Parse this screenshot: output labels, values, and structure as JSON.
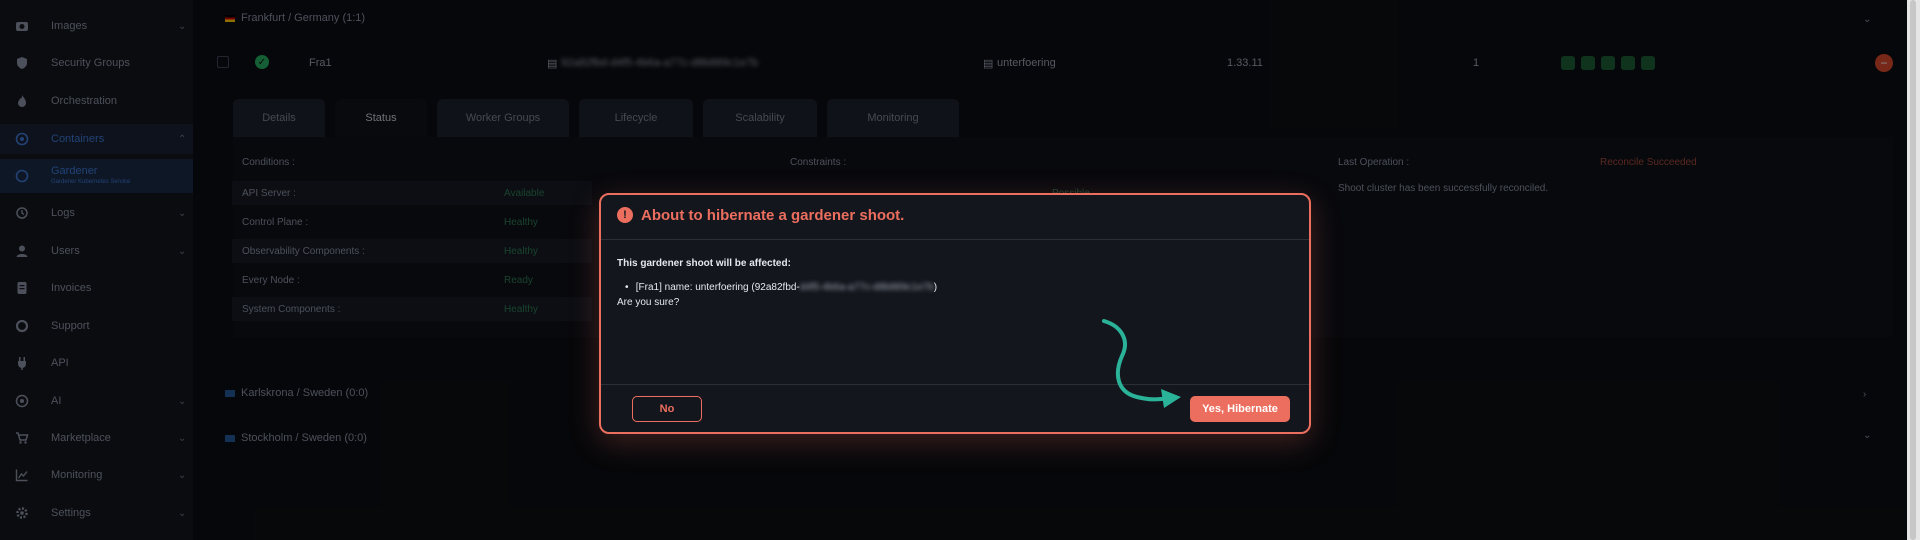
{
  "sidebar": {
    "items": [
      {
        "label": "Images",
        "icon": "camera-icon",
        "chevron": true
      },
      {
        "label": "Security Groups",
        "icon": "shield-icon",
        "chevron": false
      },
      {
        "label": "Orchestration",
        "icon": "flame-icon",
        "chevron": false
      },
      {
        "label": "Containers",
        "icon": "container-icon",
        "chevron": true
      },
      {
        "label": "Gardener",
        "sublabel": "Gardener Kubernetes Service",
        "icon": "gardener-icon"
      },
      {
        "label": "Logs",
        "icon": "history-icon",
        "chevron": true
      },
      {
        "label": "Users",
        "icon": "user-icon",
        "chevron": true
      },
      {
        "label": "Invoices",
        "icon": "invoice-icon",
        "chevron": false
      },
      {
        "label": "Support",
        "icon": "lifebuoy-icon",
        "chevron": false
      },
      {
        "label": "API",
        "icon": "plug-icon",
        "chevron": false
      },
      {
        "label": "AI",
        "icon": "ai-icon",
        "chevron": true
      },
      {
        "label": "Marketplace",
        "icon": "cart-icon",
        "chevron": true
      },
      {
        "label": "Monitoring",
        "icon": "chart-icon",
        "chevron": true
      },
      {
        "label": "Settings",
        "icon": "gear-icon",
        "chevron": true
      }
    ]
  },
  "regions": {
    "frankfurt": "Frankfurt / Germany (1:1)",
    "karlskrona": "Karlskrona / Sweden (0:0)",
    "stockholm": "Stockholm / Sweden (0:0)"
  },
  "shoot": {
    "name": "Fra1",
    "id": "92a82fbd-d4f5-4b6a-a77c-d8b889c1e7b",
    "project": "unterfoering",
    "version": "1.33.11",
    "count": "1"
  },
  "tabs": [
    "Details",
    "Status",
    "Worker Groups",
    "Lifecycle",
    "Scalability",
    "Monitoring"
  ],
  "status": {
    "conditions_title": "Conditions :",
    "constraints_title": "Constraints :",
    "last_operation_title": "Last Operation :",
    "last_operation_status": "Reconcile Succeeded",
    "last_operation_message": "Shoot cluster has been successfully reconciled.",
    "conditions": [
      {
        "name": "API Server :",
        "value": "Available"
      },
      {
        "name": "Control Plane :",
        "value": "Healthy"
      },
      {
        "name": "Observability Components :",
        "value": "Healthy"
      },
      {
        "name": "Every Node :",
        "value": "Ready"
      },
      {
        "name": "System Components :",
        "value": "Healthy"
      }
    ],
    "constraint_value": "Possible"
  },
  "modal": {
    "title": "About to hibernate a gardener shoot.",
    "affected_text": "This gardener shoot will be affected:",
    "item_prefix": "[Fra1] name: unterfoering (92a82fbd-",
    "item_masked": "d4f5-4b6a-a77c-d8b889c1e7b",
    "item_suffix": ")",
    "question": "Are you sure?",
    "no_label": "No",
    "yes_label": "Yes, Hibernate"
  },
  "colors": {
    "accent": "#ec6e5e",
    "arrow": "#2bb39a",
    "ok": "#27ae60",
    "link": "#3e78d6"
  }
}
